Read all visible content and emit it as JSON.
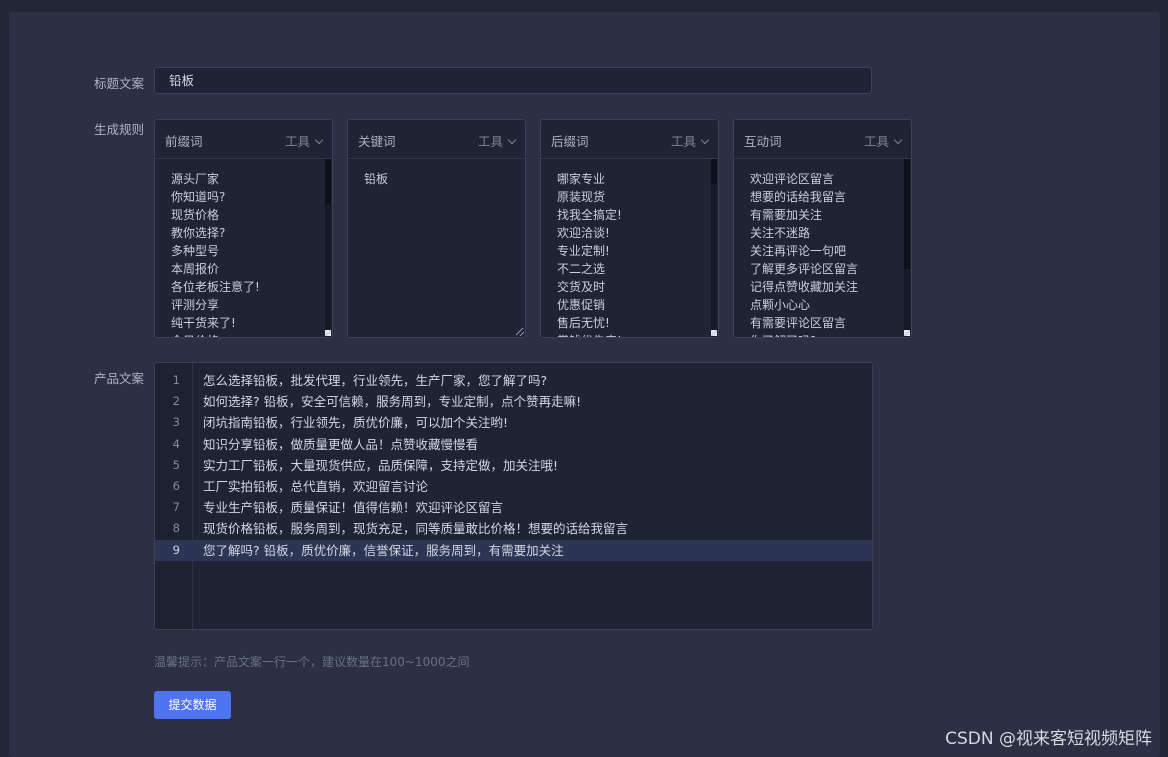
{
  "form": {
    "title_label": "标题文案",
    "title_value": "铅板",
    "rules_label": "生成规则",
    "product_label": "产品文案",
    "hint": "温馨提示：产品文案一行一个，建议数量在100~1000之间",
    "submit_label": "提交数据"
  },
  "rules": [
    {
      "title": "前缀词",
      "tools_label": "工具",
      "items": [
        "源头厂家",
        "你知道吗?",
        "现货价格",
        "教你选择?",
        "多种型号",
        "本周报价",
        "各位老板注意了!",
        "评测分享",
        "纯干货来了!",
        "今日价格"
      ]
    },
    {
      "title": "关键词",
      "tools_label": "工具",
      "items": [
        "铅板"
      ]
    },
    {
      "title": "后缀词",
      "tools_label": "工具",
      "items": [
        "哪家专业",
        "原装现货",
        "找我全搞定!",
        "欢迎洽谈!",
        "专业定制!",
        "不二之选",
        "交货及时",
        "优惠促销",
        "售后无忧!",
        "赏钱优先产!"
      ]
    },
    {
      "title": "互动词",
      "tools_label": "工具",
      "items": [
        "欢迎评论区留言",
        "想要的话给我留言",
        "有需要加关注",
        "关注不迷路",
        "关注再评论一句吧",
        "了解更多评论区留言",
        "记得点赞收藏加关注",
        "点颗小心心",
        "有需要评论区留言",
        "你了解了吗?"
      ]
    }
  ],
  "editor": {
    "active_line": 9,
    "lines": [
      {
        "n": "1",
        "text": "怎么选择铅板，批发代理，行业领先，生产厂家，您了解了吗?"
      },
      {
        "n": "2",
        "text": "如何选择? 铅板，安全可信赖，服务周到，专业定制，点个赞再走嘛!"
      },
      {
        "n": "3",
        "text": "闭坑指南铅板，行业领先，质优价廉，可以加个关注哟!"
      },
      {
        "n": "4",
        "text": "知识分享铅板，做质量更做人品！点赞收藏慢慢看"
      },
      {
        "n": "5",
        "text": "实力工厂铅板，大量现货供应，品质保障，支持定做，加关注哦!"
      },
      {
        "n": "6",
        "text": "工厂实拍铅板，总代直销，欢迎留言讨论"
      },
      {
        "n": "7",
        "text": "专业生产铅板，质量保证！值得信赖！欢迎评论区留言"
      },
      {
        "n": "8",
        "text": "现货价格铅板，服务周到，现货充足，同等质量敢比价格！想要的话给我留言"
      },
      {
        "n": "9",
        "text": "您了解吗? 铅板，质优价廉，信誉保证，服务周到，有需要加关注"
      }
    ]
  },
  "watermark": "CSDN @视来客短视频矩阵"
}
